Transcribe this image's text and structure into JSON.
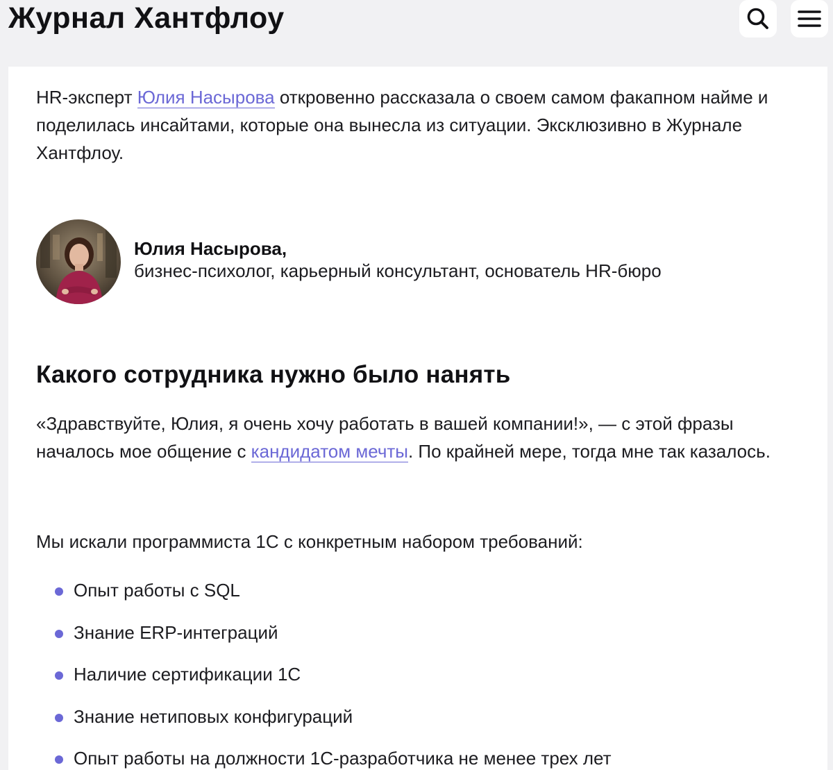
{
  "header": {
    "site_title": "Журнал Хантфлоу",
    "search_icon": "search-icon",
    "menu_icon": "hamburger-menu-icon"
  },
  "article": {
    "intro_prefix": "HR-эксперт ",
    "intro_link": "Юлия Насырова",
    "intro_suffix": " откровенно рассказала о своем самом факапном найме и поделилась инсайтами, которые она вынесла из ситуации. Эксклюзивно в Журнале Хантфлоу.",
    "author": {
      "name": "Юлия Насырова,",
      "role": "бизнес-психолог, карьерный консультант, основатель HR-бюро"
    },
    "section_heading": "Какого сотрудника нужно было нанять",
    "para1_prefix": "«Здравствуйте, Юлия, я очень хочу работать в вашей компании!», — с этой фразы началось мое общение с ",
    "para1_link": "кандидатом мечты",
    "para1_suffix": ". По крайней мере, тогда мне так казалось.",
    "para2": "Мы искали программиста 1С с конкретным набором требований:",
    "requirements": [
      "Опыт работы с SQL",
      "Знание ERP-интеграций",
      "Наличие сертификации 1С",
      "Знание нетиповых конфигураций",
      "Опыт работы на должности 1С-разработчика не менее трех лет"
    ]
  },
  "colors": {
    "accent": "#6b68d6",
    "background": "#f1f1f3",
    "card": "#ffffff",
    "text": "#1c1c20"
  }
}
